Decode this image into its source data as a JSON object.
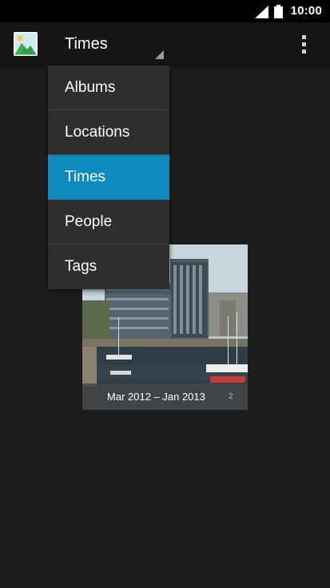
{
  "status_bar": {
    "time": "10:00",
    "icons": [
      "signal-icon",
      "battery-icon"
    ]
  },
  "action_bar": {
    "app_icon": "gallery-icon",
    "spinner_label": "Times",
    "overflow_icon": "more-vert-icon"
  },
  "menu": {
    "items": [
      {
        "label": "Albums"
      },
      {
        "label": "Locations"
      },
      {
        "label": "Times",
        "selected": true
      },
      {
        "label": "People"
      },
      {
        "label": "Tags"
      }
    ],
    "selected_color": "#0f8abe"
  },
  "album": {
    "date_range": "Mar 2012 – Jan 2013",
    "count": "2"
  }
}
